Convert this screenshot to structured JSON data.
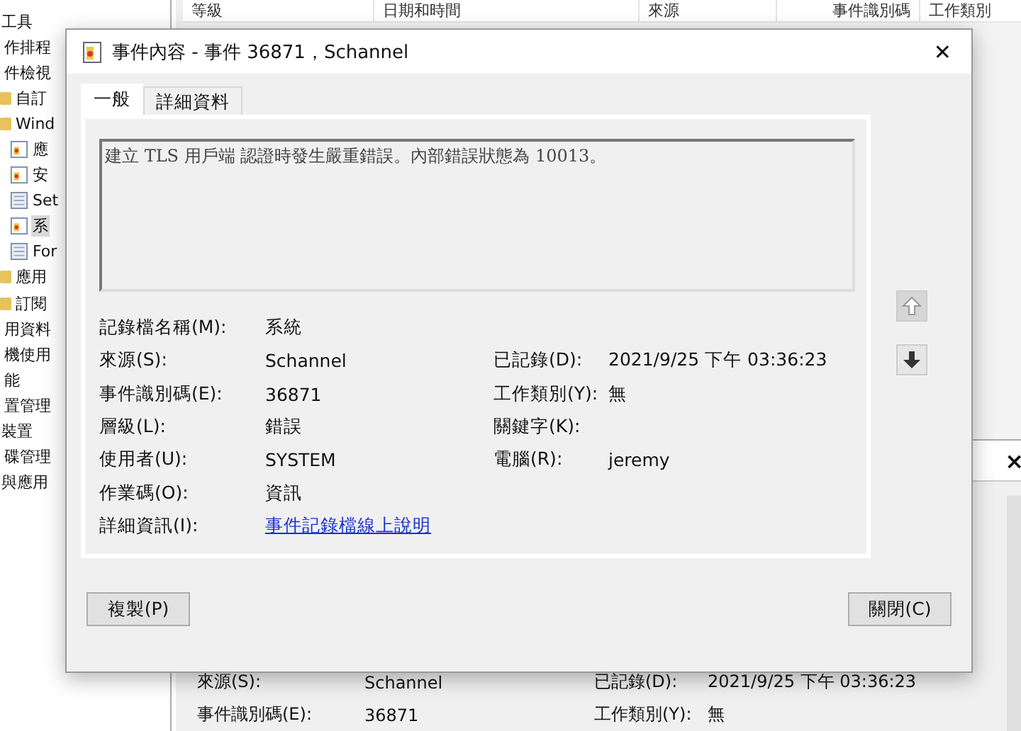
{
  "background": {
    "tree": [
      {
        "label": "工具",
        "selected": false,
        "children": [
          {
            "label": "作排程",
            "selected": false
          },
          {
            "label": "件檢視",
            "selected": false,
            "children": [
              {
                "label": "自訂",
                "kind": "folder",
                "selected": false
              },
              {
                "label": "Wind",
                "kind": "folder",
                "selected": false,
                "children": [
                  {
                    "label": "應",
                    "kind": "log",
                    "selected": false
                  },
                  {
                    "label": "安",
                    "kind": "log",
                    "selected": false
                  },
                  {
                    "label": "Set",
                    "kind": "page",
                    "selected": false
                  },
                  {
                    "label": "系",
                    "kind": "log",
                    "selected": true
                  },
                  {
                    "label": "For",
                    "kind": "page",
                    "selected": false
                  }
                ]
              },
              {
                "label": "應用",
                "kind": "folder",
                "selected": false
              },
              {
                "label": "訂閱",
                "kind": "folder",
                "selected": false
              }
            ]
          },
          {
            "label": "用資料",
            "selected": false
          },
          {
            "label": "機使用",
            "selected": false
          },
          {
            "label": "能",
            "selected": false
          },
          {
            "label": "置管理",
            "selected": false
          }
        ]
      },
      {
        "label": "裝置",
        "selected": false,
        "children": [
          {
            "label": "碟管理",
            "selected": false
          }
        ]
      },
      {
        "label": "與應用",
        "selected": false
      }
    ],
    "table": {
      "columns": [
        "等級",
        "日期和時間",
        "來源",
        "事件識別碼",
        "工作類別"
      ]
    },
    "preview": {
      "close": "×",
      "rows": [
        {
          "label": "來源(S):",
          "value": "Schannel",
          "label2": "已記錄(D):",
          "value2": "2021/9/25 下午 03:36:23"
        },
        {
          "label": "事件識別碼(E):",
          "value": "36871",
          "label2": "工作類別(Y):",
          "value2": "無"
        }
      ]
    }
  },
  "dialog": {
    "title": "事件內容 - 事件 36871，Schannel",
    "close": "✕",
    "tabs": [
      {
        "label": "一般",
        "selected": true
      },
      {
        "label": "詳細資料",
        "selected": false
      }
    ],
    "message": "建立 TLS 用戶端 認證時發生嚴重錯誤。內部錯誤狀態為 10013。",
    "fields": [
      {
        "label": "記錄檔名稱(M):",
        "value": "系統"
      },
      {
        "label": "來源(S):",
        "value": "Schannel",
        "label2": "已記錄(D):",
        "value2": "2021/9/25 下午 03:36:23"
      },
      {
        "label": "事件識別碼(E):",
        "value": "36871",
        "label2": "工作類別(Y):",
        "value2": "無"
      },
      {
        "label": "層級(L):",
        "value": "錯誤",
        "label2": "關鍵字(K):"
      },
      {
        "label": "使用者(U):",
        "value": "SYSTEM",
        "label2": "電腦(R):",
        "value2": "jeremy"
      },
      {
        "label": "作業碼(O):",
        "value": "資訊"
      },
      {
        "label": "詳細資訊(I):",
        "value": "事件記錄檔線上說明",
        "kind": "link"
      }
    ],
    "nav": [
      {
        "kind": "up",
        "disabled": true
      },
      {
        "kind": "down",
        "disabled": false
      }
    ],
    "buttons": [
      "複製(P)",
      "關閉(C)"
    ]
  }
}
